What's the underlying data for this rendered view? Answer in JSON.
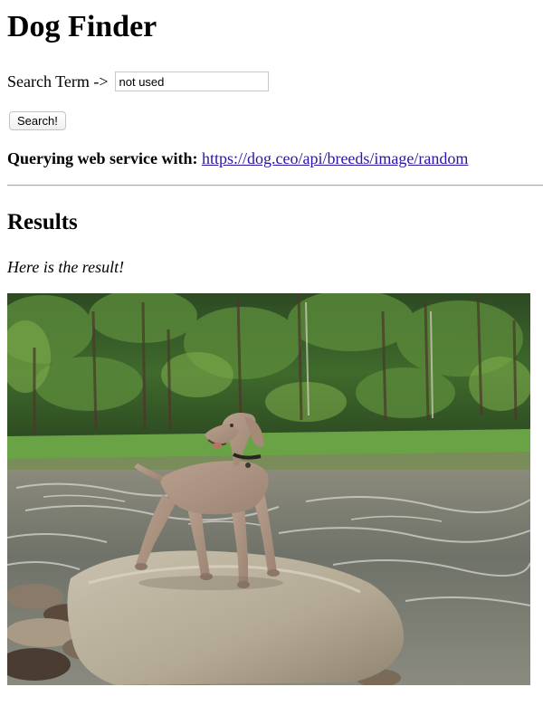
{
  "page": {
    "title": "Dog Finder"
  },
  "search": {
    "label": "Search Term ->",
    "value": "not used",
    "button_label": "Search!"
  },
  "query": {
    "label": "Querying web service with:",
    "url": "https://dog.ceo/api/breeds/image/random"
  },
  "results": {
    "heading": "Results",
    "message": "Here is the result!",
    "image_subject": "weimaraner dog standing on a rock beside a river with a forest behind"
  },
  "colors": {
    "link": "#2b13a8",
    "divider": "#a9a9a9"
  }
}
